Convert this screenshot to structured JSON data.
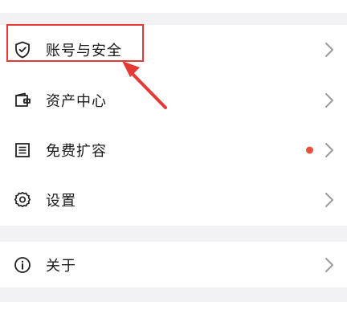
{
  "menu": {
    "items": [
      {
        "key": "account",
        "label": "账号与安全",
        "icon": "shield-check-icon"
      },
      {
        "key": "assets",
        "label": "资产中心",
        "icon": "wallet-icon"
      },
      {
        "key": "expand",
        "label": "免费扩容",
        "icon": "list-icon",
        "badge": "red-dot"
      },
      {
        "key": "settings",
        "label": "设置",
        "icon": "gear-icon"
      }
    ],
    "about": {
      "label": "关于",
      "icon": "info-icon"
    }
  },
  "colors": {
    "annotation": "#e53935",
    "badge": "#e8503a",
    "chevron": "#9a9a9a",
    "background": "#f2f2f5"
  }
}
